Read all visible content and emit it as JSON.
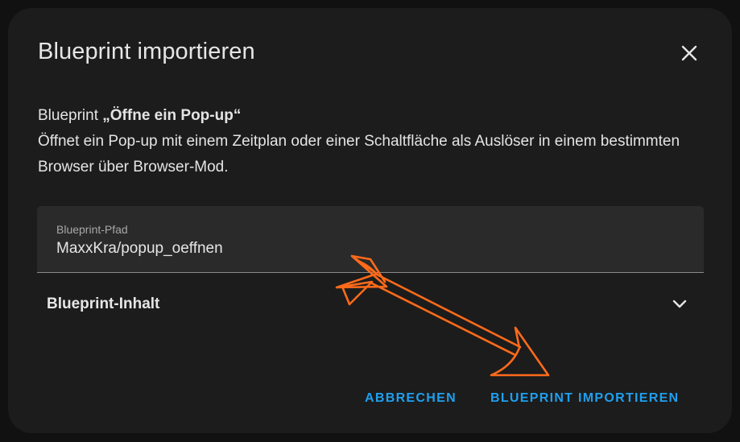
{
  "dialog": {
    "title": "Blueprint importieren",
    "close_icon": "close-icon"
  },
  "description": {
    "prefix": "Blueprint ",
    "name": "„Öffne ein Pop-up“",
    "text": "Öffnet ein Pop-up mit einem Zeitplan oder einer Schaltfläche als Auslöser in einem bestimmten Browser über Browser-Mod."
  },
  "path_field": {
    "label": "Blueprint-Pfad",
    "value": "MaxxKra/popup_oeffnen"
  },
  "content_expander": {
    "label": "Blueprint-Inhalt",
    "icon": "chevron-down-icon"
  },
  "actions": {
    "cancel_label": "ABBRECHEN",
    "import_label": "BLUEPRINT IMPORTIEREN"
  },
  "colors": {
    "accent": "#1ea0f0",
    "annotation_arrow": "#ff6a1a",
    "dialog_bg": "#1c1c1c",
    "field_bg": "#2a2a2a"
  }
}
